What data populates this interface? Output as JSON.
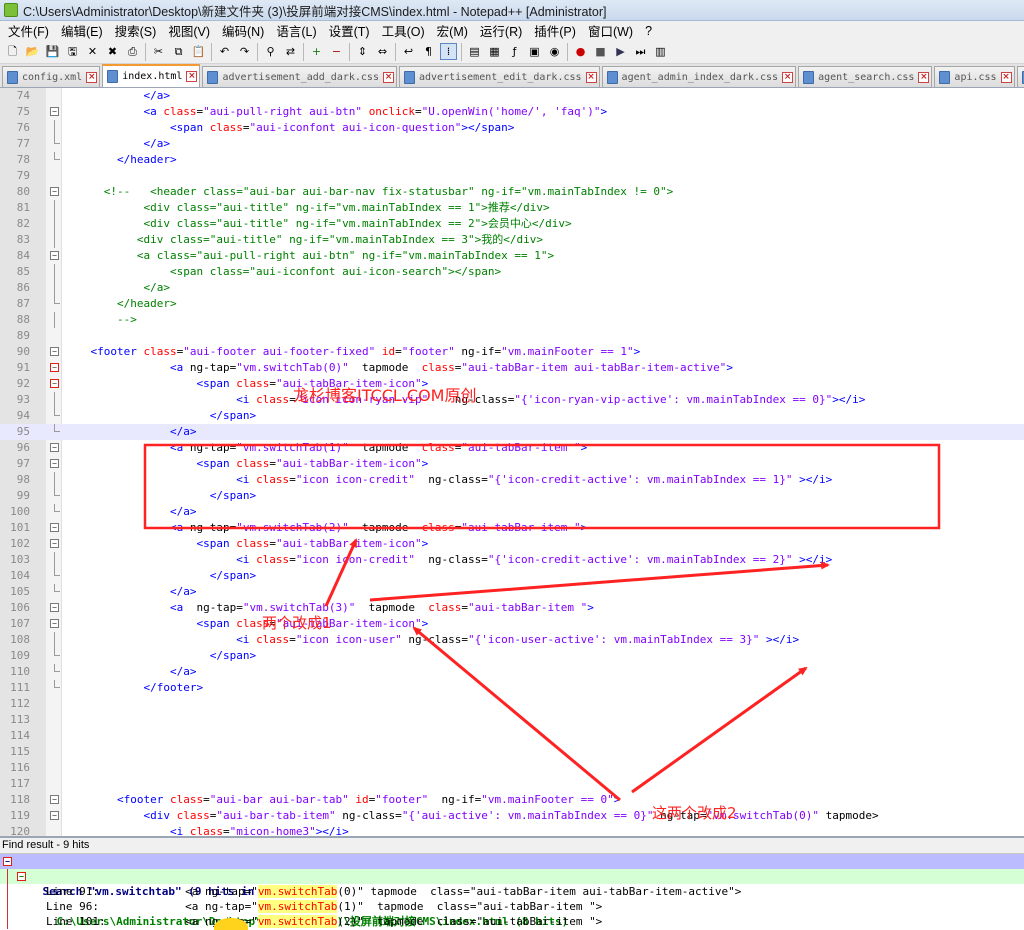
{
  "window": {
    "title": "C:\\Users\\Administrator\\Desktop\\新建文件夹 (3)\\投屏前端对接CMS\\index.html - Notepad++ [Administrator]"
  },
  "menu": [
    "文件(F)",
    "编辑(E)",
    "搜索(S)",
    "视图(V)",
    "编码(N)",
    "语言(L)",
    "设置(T)",
    "工具(O)",
    "宏(M)",
    "运行(R)",
    "插件(P)",
    "窗口(W)",
    "?"
  ],
  "toolbar_icons": [
    "new-file-icon",
    "open-file-icon",
    "save-icon",
    "save-all-icon",
    "close-icon",
    "close-all-icon",
    "print-icon",
    "|",
    "cut-icon",
    "copy-icon",
    "paste-icon",
    "|",
    "undo-icon",
    "redo-icon",
    "|",
    "find-icon",
    "replace-icon",
    "|",
    "zoom-in-icon",
    "zoom-out-icon",
    "|",
    "sync-v-icon",
    "sync-h-icon",
    "|",
    "word-wrap-icon",
    "all-chars-icon",
    "indent-guide-icon",
    "|",
    "udl-icon",
    "doc-map-icon",
    "function-list-icon",
    "folder-workspace-icon",
    "monitor-icon",
    "|",
    "record-macro-icon",
    "stop-macro-icon",
    "play-macro-icon",
    "run-macro-multiple-icon",
    "save-macro-icon"
  ],
  "tabs": [
    {
      "label": "config.xml",
      "active": false
    },
    {
      "label": "index.html",
      "active": true
    },
    {
      "label": "advertisement_add_dark.css",
      "active": false
    },
    {
      "label": "advertisement_edit_dark.css",
      "active": false
    },
    {
      "label": "agent_admin_index_dark.css",
      "active": false
    },
    {
      "label": "agent_search.css",
      "active": false
    },
    {
      "label": "api.css",
      "active": false
    },
    {
      "label": "artical_",
      "active": false
    }
  ],
  "code_lines": [
    {
      "n": "74",
      "seg": [
        [
          "k",
          "            "
        ],
        [
          "t",
          "</a>"
        ]
      ]
    },
    {
      "n": "75",
      "seg": [
        [
          "k",
          "            "
        ],
        [
          "t",
          "<a "
        ],
        [
          "a",
          "class"
        ],
        [
          "k",
          "="
        ],
        [
          "v",
          "\"aui-pull-right aui-btn\""
        ],
        [
          "k",
          " "
        ],
        [
          "a",
          "onclick"
        ],
        [
          "k",
          "="
        ],
        [
          "v",
          "\"U.openWin('home/', 'faq')\""
        ],
        [
          "t",
          ">"
        ]
      ]
    },
    {
      "n": "76",
      "seg": [
        [
          "k",
          "                "
        ],
        [
          "t",
          "<span "
        ],
        [
          "a",
          "class"
        ],
        [
          "k",
          "="
        ],
        [
          "v",
          "\"aui-iconfont aui-icon-question\""
        ],
        [
          "t",
          "></span>"
        ]
      ]
    },
    {
      "n": "77",
      "seg": [
        [
          "k",
          "            "
        ],
        [
          "t",
          "</a>"
        ]
      ]
    },
    {
      "n": "78",
      "seg": [
        [
          "k",
          "        "
        ],
        [
          "t",
          "</header>"
        ]
      ]
    },
    {
      "n": "79",
      "seg": []
    },
    {
      "n": "80",
      "seg": [
        [
          "k",
          "      "
        ],
        [
          "c",
          "<!--   <header class=\"aui-bar aui-bar-nav fix-statusbar\" ng-if=\"vm.mainTabIndex != 0\">"
        ]
      ]
    },
    {
      "n": "81",
      "seg": [
        [
          "c",
          "            <div class=\"aui-title\" ng-if=\"vm.mainTabIndex == 1\">推荐</div>"
        ]
      ]
    },
    {
      "n": "82",
      "seg": [
        [
          "c",
          "            <div class=\"aui-title\" ng-if=\"vm.mainTabIndex == 2\">会员中心</div>"
        ]
      ]
    },
    {
      "n": "83",
      "seg": [
        [
          "c",
          "           <div class=\"aui-title\" ng-if=\"vm.mainTabIndex == 3\">我的</div>"
        ]
      ]
    },
    {
      "n": "84",
      "seg": [
        [
          "c",
          "           <a class=\"aui-pull-right aui-btn\" ng-if=\"vm.mainTabIndex == 1\">"
        ]
      ]
    },
    {
      "n": "85",
      "seg": [
        [
          "c",
          "                <span class=\"aui-iconfont aui-icon-search\"></span>"
        ]
      ]
    },
    {
      "n": "86",
      "seg": [
        [
          "c",
          "            </a>"
        ]
      ]
    },
    {
      "n": "87",
      "seg": [
        [
          "c",
          "        </header>"
        ]
      ]
    },
    {
      "n": "88",
      "seg": [
        [
          "c",
          "        -->"
        ]
      ]
    },
    {
      "n": "89",
      "seg": []
    },
    {
      "n": "90",
      "seg": [
        [
          "k",
          "    "
        ],
        [
          "t",
          "<footer "
        ],
        [
          "a",
          "class"
        ],
        [
          "k",
          "="
        ],
        [
          "v",
          "\"aui-footer aui-footer-fixed\""
        ],
        [
          "k",
          " "
        ],
        [
          "a",
          "id"
        ],
        [
          "k",
          "="
        ],
        [
          "v",
          "\"footer\""
        ],
        [
          "k",
          " ng-if="
        ],
        [
          "v",
          "\"vm.mainFooter == 1\""
        ],
        [
          "t",
          ">"
        ]
      ]
    },
    {
      "n": "91",
      "seg": [
        [
          "k",
          "                "
        ],
        [
          "t",
          "<a "
        ],
        [
          "k",
          "ng-tap="
        ],
        [
          "v",
          "\"vm.switchTab(0)\""
        ],
        [
          "k",
          "  tapmode  "
        ],
        [
          "a",
          "class"
        ],
        [
          "k",
          "="
        ],
        [
          "v",
          "\"aui-tabBar-item aui-tabBar-item-active\""
        ],
        [
          "t",
          ">"
        ]
      ]
    },
    {
      "n": "92",
      "seg": [
        [
          "k",
          "                    "
        ],
        [
          "t",
          "<span "
        ],
        [
          "a",
          "class"
        ],
        [
          "k",
          "="
        ],
        [
          "v",
          "\"aui-tabBar-item-icon\""
        ],
        [
          "t",
          ">"
        ]
      ]
    },
    {
      "n": "93",
      "seg": [
        [
          "k",
          "                          "
        ],
        [
          "t",
          "<i "
        ],
        [
          "a",
          "class"
        ],
        [
          "k",
          "="
        ],
        [
          "v",
          "\"icon icon-ryan-vip\""
        ],
        [
          "k",
          "    ng-class="
        ],
        [
          "v",
          "\"{'icon-ryan-vip-active': vm.mainTabIndex == 0}\""
        ],
        [
          "t",
          "></i>"
        ]
      ]
    },
    {
      "n": "94",
      "seg": [
        [
          "k",
          "                      "
        ],
        [
          "t",
          "</span>"
        ]
      ]
    },
    {
      "n": "95",
      "seg": [
        [
          "k",
          "                "
        ],
        [
          "t",
          "</a>"
        ]
      ],
      "current": true
    },
    {
      "n": "96",
      "seg": [
        [
          "k",
          "                "
        ],
        [
          "t",
          "<a "
        ],
        [
          "k",
          "ng-tap="
        ],
        [
          "v",
          "\"vm.switchTab(1)\""
        ],
        [
          "k",
          "  tapmode  "
        ],
        [
          "a",
          "class"
        ],
        [
          "k",
          "="
        ],
        [
          "v",
          "\"aui-tabBar-item \""
        ],
        [
          "t",
          ">"
        ]
      ]
    },
    {
      "n": "97",
      "seg": [
        [
          "k",
          "                    "
        ],
        [
          "t",
          "<span "
        ],
        [
          "a",
          "class"
        ],
        [
          "k",
          "="
        ],
        [
          "v",
          "\"aui-tabBar-item-icon\""
        ],
        [
          "t",
          ">"
        ]
      ]
    },
    {
      "n": "98",
      "seg": [
        [
          "k",
          "                          "
        ],
        [
          "t",
          "<i "
        ],
        [
          "a",
          "class"
        ],
        [
          "k",
          "="
        ],
        [
          "v",
          "\"icon icon-credit\""
        ],
        [
          "k",
          "  ng-class="
        ],
        [
          "v",
          "\"{'icon-credit-active': vm.mainTabIndex == 1}\""
        ],
        [
          "k",
          " "
        ],
        [
          "t",
          "></i>"
        ]
      ]
    },
    {
      "n": "99",
      "seg": [
        [
          "k",
          "                      "
        ],
        [
          "t",
          "</span>"
        ]
      ]
    },
    {
      "n": "100",
      "seg": [
        [
          "k",
          "                "
        ],
        [
          "t",
          "</a>"
        ]
      ]
    },
    {
      "n": "101",
      "seg": [
        [
          "k",
          "                "
        ],
        [
          "t",
          "<a "
        ],
        [
          "k",
          "ng-tap="
        ],
        [
          "v",
          "\"vm.switchTab(2)\""
        ],
        [
          "k",
          "  tapmode  "
        ],
        [
          "a",
          "class"
        ],
        [
          "k",
          "="
        ],
        [
          "v",
          "\"aui-tabBar-item \""
        ],
        [
          "t",
          ">"
        ]
      ]
    },
    {
      "n": "102",
      "seg": [
        [
          "k",
          "                    "
        ],
        [
          "t",
          "<span "
        ],
        [
          "a",
          "class"
        ],
        [
          "k",
          "="
        ],
        [
          "v",
          "\"aui-tabBar-item-icon\""
        ],
        [
          "t",
          ">"
        ]
      ]
    },
    {
      "n": "103",
      "seg": [
        [
          "k",
          "                          "
        ],
        [
          "t",
          "<i "
        ],
        [
          "a",
          "class"
        ],
        [
          "k",
          "="
        ],
        [
          "v",
          "\"icon icon-credit\""
        ],
        [
          "k",
          "  ng-class="
        ],
        [
          "v",
          "\"{'icon-credit-active': vm.mainTabIndex == 2}\""
        ],
        [
          "k",
          " "
        ],
        [
          "t",
          "></i>"
        ]
      ]
    },
    {
      "n": "104",
      "seg": [
        [
          "k",
          "                      "
        ],
        [
          "t",
          "</span>"
        ]
      ]
    },
    {
      "n": "105",
      "seg": [
        [
          "k",
          "                "
        ],
        [
          "t",
          "</a>"
        ]
      ]
    },
    {
      "n": "106",
      "seg": [
        [
          "k",
          "                "
        ],
        [
          "t",
          "<a  "
        ],
        [
          "k",
          "ng-tap="
        ],
        [
          "v",
          "\"vm.switchTab(3)\""
        ],
        [
          "k",
          "  tapmode  "
        ],
        [
          "a",
          "class"
        ],
        [
          "k",
          "="
        ],
        [
          "v",
          "\"aui-tabBar-item \""
        ],
        [
          "t",
          ">"
        ]
      ]
    },
    {
      "n": "107",
      "seg": [
        [
          "k",
          "                    "
        ],
        [
          "t",
          "<span "
        ],
        [
          "a",
          "class"
        ],
        [
          "k",
          "="
        ],
        [
          "v",
          "\"aui-tabBar-item-icon\""
        ],
        [
          "t",
          ">"
        ]
      ]
    },
    {
      "n": "108",
      "seg": [
        [
          "k",
          "                          "
        ],
        [
          "t",
          "<i "
        ],
        [
          "a",
          "class"
        ],
        [
          "k",
          "="
        ],
        [
          "v",
          "\"icon icon-user\""
        ],
        [
          "k",
          " ng-class="
        ],
        [
          "v",
          "\"{'icon-user-active': vm.mainTabIndex == 3}\""
        ],
        [
          "k",
          " "
        ],
        [
          "t",
          "></i>"
        ]
      ]
    },
    {
      "n": "109",
      "seg": [
        [
          "k",
          "                      "
        ],
        [
          "t",
          "</span>"
        ]
      ]
    },
    {
      "n": "110",
      "seg": [
        [
          "k",
          "                "
        ],
        [
          "t",
          "</a>"
        ]
      ]
    },
    {
      "n": "111",
      "seg": [
        [
          "k",
          "            "
        ],
        [
          "t",
          "</footer>"
        ]
      ]
    },
    {
      "n": "112",
      "seg": []
    },
    {
      "n": "113",
      "seg": []
    },
    {
      "n": "114",
      "seg": []
    },
    {
      "n": "115",
      "seg": []
    },
    {
      "n": "116",
      "seg": []
    },
    {
      "n": "117",
      "seg": []
    },
    {
      "n": "118",
      "seg": [
        [
          "k",
          "        "
        ],
        [
          "t",
          "<footer "
        ],
        [
          "a",
          "class"
        ],
        [
          "k",
          "="
        ],
        [
          "v",
          "\"aui-bar aui-bar-tab\""
        ],
        [
          "k",
          " "
        ],
        [
          "a",
          "id"
        ],
        [
          "k",
          "="
        ],
        [
          "v",
          "\"footer\""
        ],
        [
          "k",
          "  ng-if="
        ],
        [
          "v",
          "\"vm.mainFooter == 0\""
        ],
        [
          "t",
          ">"
        ]
      ]
    },
    {
      "n": "119",
      "seg": [
        [
          "k",
          "            "
        ],
        [
          "t",
          "<div "
        ],
        [
          "a",
          "class"
        ],
        [
          "k",
          "="
        ],
        [
          "v",
          "\"aui-bar-tab-item\""
        ],
        [
          "k",
          " ng-class="
        ],
        [
          "v",
          "\"{'aui-active': vm.mainTabIndex == 0}\""
        ],
        [
          "k",
          " ng-tap="
        ],
        [
          "v",
          "\"vm.switchTab(0)\""
        ],
        [
          "k",
          " tapmode>"
        ]
      ]
    },
    {
      "n": "120",
      "seg": [
        [
          "k",
          "                "
        ],
        [
          "t",
          "<i "
        ],
        [
          "a",
          "class"
        ],
        [
          "k",
          "="
        ],
        [
          "v",
          "\"micon-home3\""
        ],
        [
          "t",
          "></i>"
        ]
      ]
    }
  ],
  "annotations": {
    "watermark": "尨杉博客ITCCL.COM原创",
    "label1": "两个改成1",
    "label2": "这两个改成2"
  },
  "find_results": {
    "header": "Find result - 9 hits",
    "search_line": "Search \"vm.switchtab\" (9 hits in 2 files)",
    "file_line": "C:\\Users\\Administrator\\Desktop\\新建文件夹 (3)\\投屏前端对接CMS\\index.html (8 hits)",
    "hits": [
      {
        "pre": "Line 91:             <a ng-tap=\"",
        "hl": "vm.switchTab",
        "post": "(0)\" tapmode  class=\"aui-tabBar-item aui-tabBar-item-active\">"
      },
      {
        "pre": "Line 96:             <a ng-tap=\"",
        "hl": "vm.switchTab",
        "post": "(1)\"  tapmode  class=\"aui-tabBar-item \">"
      },
      {
        "pre": "Line 101:            <a ng-tap=\"",
        "hl": "vm.switchTab",
        "post": "(2)\"  tapmode  class=\"aui-tabBar-item \">"
      }
    ]
  },
  "colors": {
    "tag": "#0000ff",
    "attr": "#ff0000",
    "value": "#8000ff",
    "comment": "#008000",
    "annotation": "#ff2222"
  }
}
